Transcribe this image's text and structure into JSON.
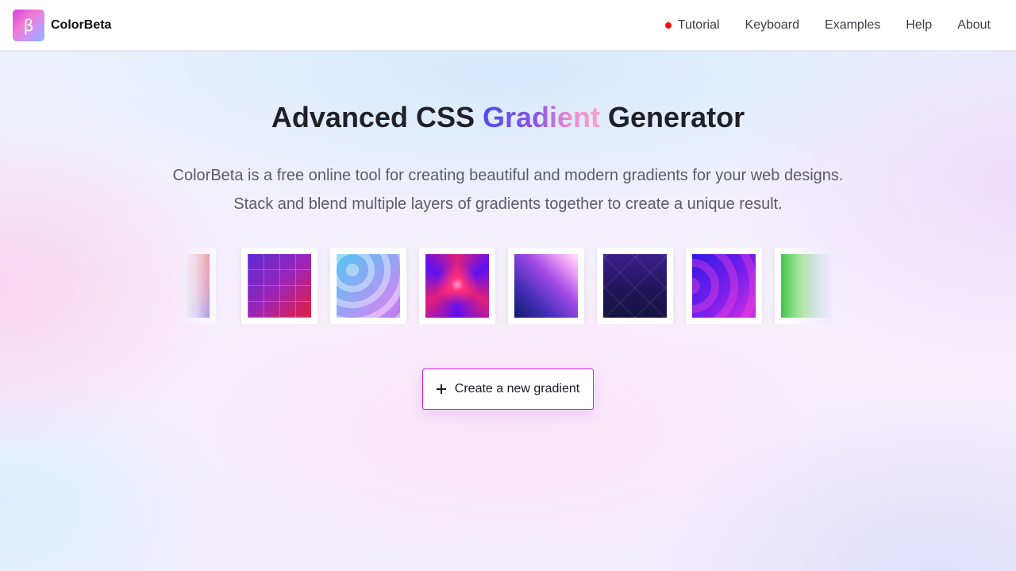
{
  "brand": {
    "logo_glyph": "β",
    "name": "ColorBeta"
  },
  "nav": {
    "items": [
      {
        "label": "Tutorial",
        "has_dot": true,
        "dot_color": "#f01010"
      },
      {
        "label": "Keyboard"
      },
      {
        "label": "Examples"
      },
      {
        "label": "Help"
      },
      {
        "label": "About"
      }
    ]
  },
  "hero": {
    "title_before": "Advanced CSS ",
    "title_accent": "Gradient",
    "title_after": " Generator",
    "description_line1": "ColorBeta is a free online tool for creating beautiful and modern gradients for your web designs.",
    "description_line2": "Stack and blend multiple layers of gradients together to create a unique result."
  },
  "gallery": {
    "items": [
      {
        "name": "red-blue-vertical"
      },
      {
        "name": "purple-red-grid"
      },
      {
        "name": "blue-pink-waves"
      },
      {
        "name": "magenta-flower-burst"
      },
      {
        "name": "navy-pink-diagonal"
      },
      {
        "name": "dark-purple-diamonds"
      },
      {
        "name": "violet-magenta-circles"
      },
      {
        "name": "green-blue-horizontal"
      }
    ]
  },
  "actions": {
    "create_label": "Create a new gradient"
  },
  "colors": {
    "accent_border": "#d31fe0",
    "title_accent_start": "#4e4fe8",
    "title_accent_end": "#f5a2c6",
    "text_dark": "#1f2029",
    "text_muted": "#5b5b6b"
  },
  "icons": {
    "plus": "plus-icon",
    "tutorial_dot": "red-dot-icon"
  }
}
